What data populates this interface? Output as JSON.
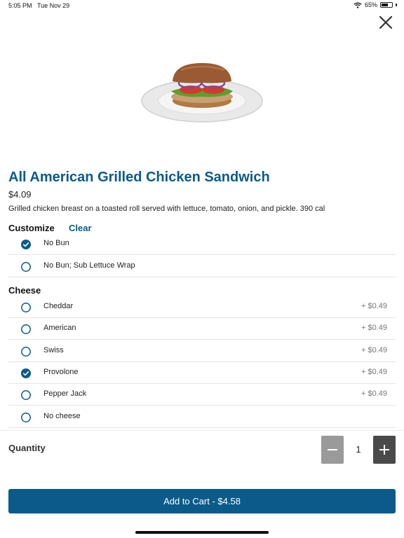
{
  "status_bar": {
    "time": "5:05 PM",
    "date": "Tue Nov 29",
    "battery": "65%",
    "battery_fraction": 0.65
  },
  "product": {
    "title": "All American Grilled Chicken Sandwich",
    "price": "$4.09",
    "description": "Grilled chicken breast on a toasted roll served with lettuce, tomato, onion, and pickle. 390 cal"
  },
  "customize": {
    "heading": "Customize",
    "clear_label": "Clear",
    "options": [
      {
        "label": "No Bun",
        "selected": true,
        "price": ""
      },
      {
        "label": "No Bun; Sub Lettuce Wrap",
        "selected": false,
        "price": ""
      }
    ]
  },
  "cheese": {
    "heading": "Cheese",
    "options": [
      {
        "label": "Cheddar",
        "selected": false,
        "price": "+ $0.49"
      },
      {
        "label": "American",
        "selected": false,
        "price": "+ $0.49"
      },
      {
        "label": "Swiss",
        "selected": false,
        "price": "+ $0.49"
      },
      {
        "label": "Provolone",
        "selected": true,
        "price": "+ $0.49"
      },
      {
        "label": "Pepper Jack",
        "selected": false,
        "price": "+ $0.49"
      },
      {
        "label": "No cheese",
        "selected": false,
        "price": ""
      }
    ]
  },
  "quantity": {
    "label": "Quantity",
    "value": "1"
  },
  "cart": {
    "button_label": "Add to Cart - $4.58"
  },
  "colors": {
    "accent": "#0a5b8a",
    "minus_button": "#9a9a9a",
    "plus_button": "#4a4a4a"
  },
  "icons": [
    "wifi-icon",
    "battery-icon",
    "close-icon",
    "checked-radio-icon",
    "radio-icon",
    "minus-icon",
    "plus-icon"
  ]
}
